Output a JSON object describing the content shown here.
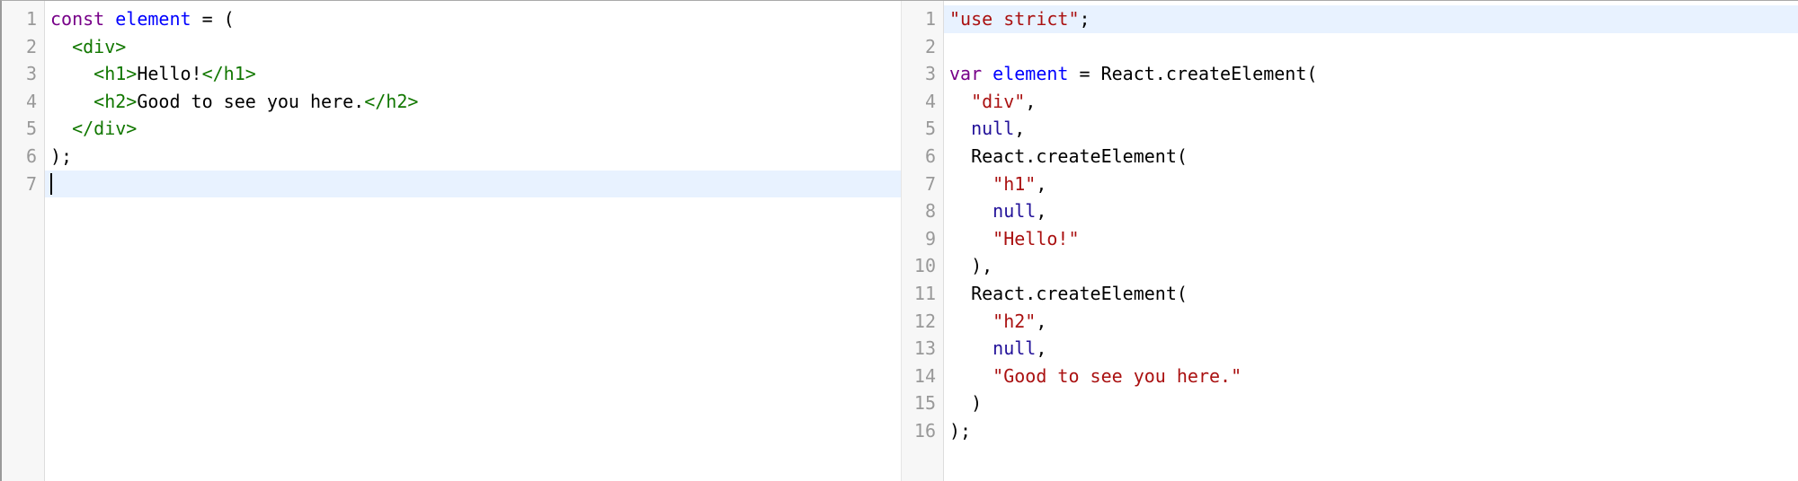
{
  "left_editor": {
    "line_numbers": [
      "1",
      "2",
      "3",
      "4",
      "5",
      "6",
      "7"
    ],
    "lines": [
      {
        "tokens": [
          {
            "t": "const",
            "c": "kw-purple"
          },
          {
            "t": " ",
            "c": "plain"
          },
          {
            "t": "element",
            "c": "def-blue"
          },
          {
            "t": " = (",
            "c": "plain"
          }
        ]
      },
      {
        "tokens": [
          {
            "t": "  ",
            "c": "plain"
          },
          {
            "t": "<div>",
            "c": "tag-green"
          }
        ]
      },
      {
        "tokens": [
          {
            "t": "    ",
            "c": "plain"
          },
          {
            "t": "<h1>",
            "c": "tag-green"
          },
          {
            "t": "Hello!",
            "c": "plain"
          },
          {
            "t": "</h1>",
            "c": "tag-green"
          }
        ]
      },
      {
        "tokens": [
          {
            "t": "    ",
            "c": "plain"
          },
          {
            "t": "<h2>",
            "c": "tag-green"
          },
          {
            "t": "Good to see you here.",
            "c": "plain"
          },
          {
            "t": "</h2>",
            "c": "tag-green"
          }
        ]
      },
      {
        "tokens": [
          {
            "t": "  ",
            "c": "plain"
          },
          {
            "t": "</div>",
            "c": "tag-green"
          }
        ]
      },
      {
        "tokens": [
          {
            "t": ");",
            "c": "plain"
          }
        ]
      },
      {
        "tokens": [],
        "active": true,
        "cursor": true
      }
    ]
  },
  "right_editor": {
    "line_numbers": [
      "1",
      "2",
      "3",
      "4",
      "5",
      "6",
      "7",
      "8",
      "9",
      "10",
      "11",
      "12",
      "13",
      "14",
      "15",
      "16"
    ],
    "lines": [
      {
        "active": true,
        "tokens": [
          {
            "t": "\"use strict\"",
            "c": "str-red"
          },
          {
            "t": ";",
            "c": "plain"
          }
        ]
      },
      {
        "tokens": []
      },
      {
        "tokens": [
          {
            "t": "var",
            "c": "kw-purple"
          },
          {
            "t": " ",
            "c": "plain"
          },
          {
            "t": "element",
            "c": "def-blue"
          },
          {
            "t": " = React.createElement(",
            "c": "plain"
          }
        ]
      },
      {
        "tokens": [
          {
            "t": "  ",
            "c": "plain"
          },
          {
            "t": "\"div\"",
            "c": "str-red"
          },
          {
            "t": ",",
            "c": "plain"
          }
        ]
      },
      {
        "tokens": [
          {
            "t": "  ",
            "c": "plain"
          },
          {
            "t": "null",
            "c": "atom"
          },
          {
            "t": ",",
            "c": "plain"
          }
        ]
      },
      {
        "tokens": [
          {
            "t": "  React.createElement(",
            "c": "plain"
          }
        ]
      },
      {
        "tokens": [
          {
            "t": "    ",
            "c": "plain"
          },
          {
            "t": "\"h1\"",
            "c": "str-red"
          },
          {
            "t": ",",
            "c": "plain"
          }
        ]
      },
      {
        "tokens": [
          {
            "t": "    ",
            "c": "plain"
          },
          {
            "t": "null",
            "c": "atom"
          },
          {
            "t": ",",
            "c": "plain"
          }
        ]
      },
      {
        "tokens": [
          {
            "t": "    ",
            "c": "plain"
          },
          {
            "t": "\"Hello!\"",
            "c": "str-red"
          }
        ]
      },
      {
        "tokens": [
          {
            "t": "  ),",
            "c": "plain"
          }
        ]
      },
      {
        "tokens": [
          {
            "t": "  React.createElement(",
            "c": "plain"
          }
        ]
      },
      {
        "tokens": [
          {
            "t": "    ",
            "c": "plain"
          },
          {
            "t": "\"h2\"",
            "c": "str-red"
          },
          {
            "t": ",",
            "c": "plain"
          }
        ]
      },
      {
        "tokens": [
          {
            "t": "    ",
            "c": "plain"
          },
          {
            "t": "null",
            "c": "atom"
          },
          {
            "t": ",",
            "c": "plain"
          }
        ]
      },
      {
        "tokens": [
          {
            "t": "    ",
            "c": "plain"
          },
          {
            "t": "\"Good to see you here.\"",
            "c": "str-red"
          }
        ]
      },
      {
        "tokens": [
          {
            "t": "  )",
            "c": "plain"
          }
        ]
      },
      {
        "tokens": [
          {
            "t": ");",
            "c": "plain"
          }
        ]
      }
    ]
  },
  "colors": {
    "keyword": "#770088",
    "definition": "#0000ff",
    "tag": "#117700",
    "string": "#aa1111",
    "atom": "#221199",
    "active_line": "#e8f2ff",
    "gutter_bg": "#f7f7f7",
    "line_number": "#999999"
  }
}
